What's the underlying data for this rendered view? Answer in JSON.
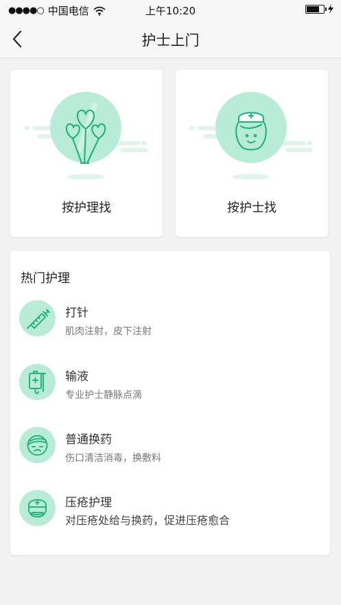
{
  "status_bar": {
    "signal": "●●●●○",
    "carrier": "中国电信",
    "time": "上午10:20"
  },
  "nav": {
    "title": "护士上门"
  },
  "search_options": [
    {
      "label": "按护理找",
      "icon": "balloons-icon"
    },
    {
      "label": "按护士找",
      "icon": "nurse-icon"
    }
  ],
  "hot": {
    "title": "热门护理",
    "items": [
      {
        "name": "打针",
        "desc": "肌肉注射，皮下注射",
        "icon": "syringe-icon"
      },
      {
        "name": "输液",
        "desc": "专业护士静脉点滴",
        "icon": "iv-drip-icon"
      },
      {
        "name": "普通换药",
        "desc": "伤口清洁消毒，换敷料",
        "icon": "bandaged-face-icon"
      },
      {
        "name": "压疮护理",
        "desc": "对压疮处给与换药，促进压疮愈合",
        "icon": "nurse-cap-icon"
      }
    ]
  },
  "colors": {
    "accent": "#24b47e",
    "accent_light": "#b9ecd8",
    "accent_pale": "#dff5ec"
  }
}
